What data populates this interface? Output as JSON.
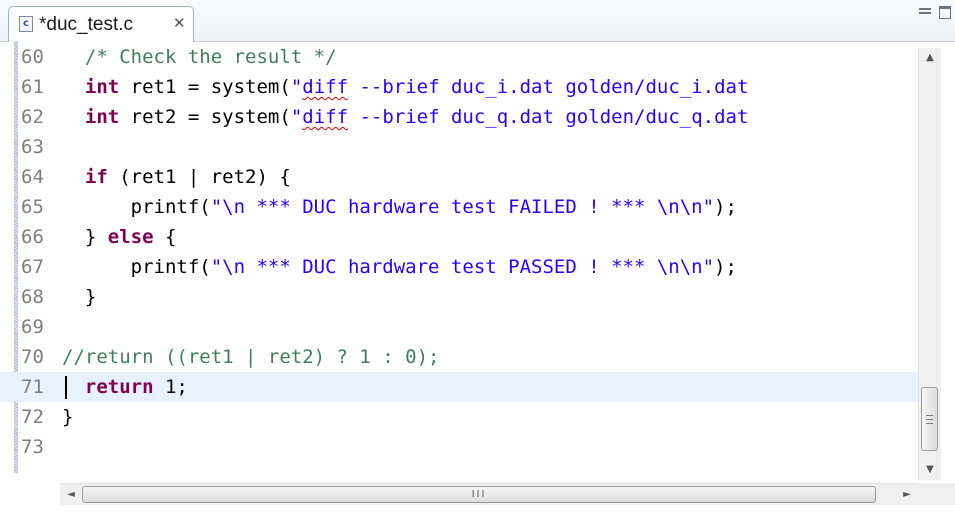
{
  "tab": {
    "title": "*duc_test.c",
    "icon": "c-source-file-icon",
    "close_glyph": "✕"
  },
  "window_controls": [
    "minimize-icon",
    "maximize-icon"
  ],
  "editor": {
    "current_line": "71",
    "lines": [
      {
        "num": "60",
        "segments": [
          {
            "t": "  ",
            "c": ""
          },
          {
            "t": "/* Check the result */",
            "c": "cm"
          }
        ]
      },
      {
        "num": "61",
        "segments": [
          {
            "t": "  ",
            "c": ""
          },
          {
            "t": "int",
            "c": "kw"
          },
          {
            "t": " ret1 = system(",
            "c": ""
          },
          {
            "t": "\"",
            "c": "str"
          },
          {
            "t": "diff",
            "c": "str squig"
          },
          {
            "t": " --brief duc_i.dat golden/duc_i.dat",
            "c": "str"
          }
        ]
      },
      {
        "num": "62",
        "segments": [
          {
            "t": "  ",
            "c": ""
          },
          {
            "t": "int",
            "c": "kw"
          },
          {
            "t": " ret2 = system(",
            "c": ""
          },
          {
            "t": "\"",
            "c": "str"
          },
          {
            "t": "diff",
            "c": "str squig"
          },
          {
            "t": " --brief duc_q.dat golden/duc_q.dat",
            "c": "str"
          }
        ]
      },
      {
        "num": "63",
        "segments": []
      },
      {
        "num": "64",
        "segments": [
          {
            "t": "  ",
            "c": ""
          },
          {
            "t": "if",
            "c": "kw"
          },
          {
            "t": " (ret1 | ret2) {",
            "c": ""
          }
        ]
      },
      {
        "num": "65",
        "segments": [
          {
            "t": "      printf(",
            "c": ""
          },
          {
            "t": "\"\\n *** DUC hardware test FAILED ! *** \\n\\n\"",
            "c": "str"
          },
          {
            "t": ");",
            "c": ""
          }
        ]
      },
      {
        "num": "66",
        "segments": [
          {
            "t": "  } ",
            "c": ""
          },
          {
            "t": "else",
            "c": "kw"
          },
          {
            "t": " {",
            "c": ""
          }
        ]
      },
      {
        "num": "67",
        "segments": [
          {
            "t": "      printf(",
            "c": ""
          },
          {
            "t": "\"\\n *** DUC hardware test PASSED ! *** \\n\\n\"",
            "c": "str"
          },
          {
            "t": ");",
            "c": ""
          }
        ]
      },
      {
        "num": "68",
        "segments": [
          {
            "t": "  }",
            "c": ""
          }
        ]
      },
      {
        "num": "69",
        "segments": []
      },
      {
        "num": "70",
        "segments": [
          {
            "t": "//return ((ret1 | ret2) ? 1 : 0);",
            "c": "cm"
          }
        ]
      },
      {
        "num": "71",
        "segments": [
          {
            "t": "  ",
            "c": ""
          },
          {
            "t": "return",
            "c": "kw"
          },
          {
            "t": " 1;",
            "c": ""
          }
        ]
      },
      {
        "num": "72",
        "segments": [
          {
            "t": "}",
            "c": ""
          }
        ]
      },
      {
        "num": "73",
        "segments": []
      }
    ]
  },
  "scrollbars": {
    "vertical": {
      "up": "▲",
      "down": "▼",
      "grip": "≡"
    },
    "horizontal": {
      "left": "◄",
      "right": "►",
      "grip": "III"
    }
  }
}
